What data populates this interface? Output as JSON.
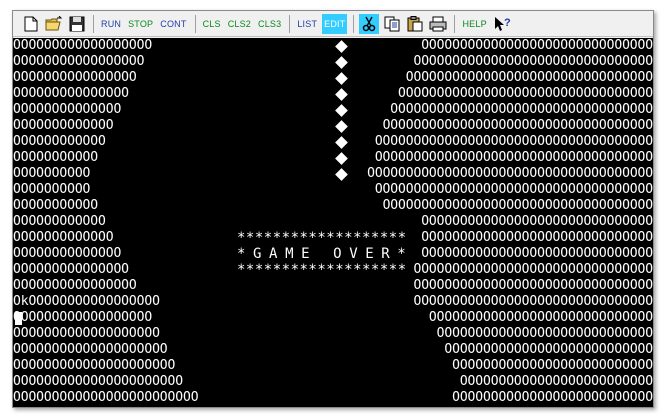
{
  "toolbar": {
    "buttons": [
      {
        "name": "new-file-button",
        "icon": "new-file-icon"
      },
      {
        "name": "open-file-button",
        "icon": "folder-open-icon"
      },
      {
        "name": "save-file-button",
        "icon": "floppy-disk-icon"
      }
    ],
    "run_label": "RUN",
    "stop_label": "STOP",
    "cont_label": "CONT",
    "cls_label": "CLS",
    "cls2_label": "CLS2",
    "cls3_label": "CLS3",
    "list_label": "LIST",
    "edit_label": "EDIT",
    "help_label": "HELP",
    "edit_icons": [
      "scissors-icon",
      "copy-icon",
      "paste-icon",
      "printer-icon"
    ],
    "whats_this_icon": "help-pointer-icon"
  },
  "screen": {
    "rows": [
      {
        "left": "OOOOOOOOOOOOOOOOOO",
        "right": "OOOOOOOOOOOOOOOOOOOOOOOOOOOOOO"
      },
      {
        "left": "OOOOOOOOOOOOOOOOO",
        "right": "OOOOOOOOOOOOOOOOOOOOOOOOOOOOOOO"
      },
      {
        "left": "OOOOOOOOOOOOOOOO",
        "right": "OOOOOOOOOOOOOOOOOOOOOOOOOOOOOOOO"
      },
      {
        "left": "OOOOOOOOOOOOOOO",
        "right": "OOOOOOOOOOOOOOOOOOOOOOOOOOOOOOOOO"
      },
      {
        "left": "OOOOOOOOOOOOOO",
        "right": "OOOOOOOOOOOOOOOOOOOOOOOOOOOOOOOOOO"
      },
      {
        "left": "OOOOOOOOOOOOO",
        "right": "OOOOOOOOOOOOOOOOOOOOOOOOOOOOOOOOOOO"
      },
      {
        "left": "OOOOOOOOOOOO",
        "right": "OOOOOOOOOOOOOOOOOOOOOOOOOOOOOOOOOOOO"
      },
      {
        "left": "OOOOOOOOOOO",
        "right": "OOOOOOOOOOOOOOOOOOOOOOOOOOOOOOOOOOOO"
      },
      {
        "left": "OOOOOOOOOO",
        "right": "OOOOOOOOOOOOOOOOOOOOOOOOOOOOOOOOOOOOO"
      },
      {
        "left": "OOOOOOOOOO",
        "right": "OOOOOOOOOOOOOOOOOOOOOOOOOOOOOOOOOOOO"
      },
      {
        "left": "OOOOOOOOOOO",
        "right": "OOOOOOOOOOOOOOOOOOOOOOOOOOOOOOOOOOO"
      },
      {
        "left": "OOOOOOOOOOOO",
        "right": "OOOOOOOOOOOOOOOOOOOOOOOOOOOOOO"
      },
      {
        "left": "OOOOOOOOOOOOO",
        "right": "OOOOOOOOOOOOOOOOOOOOOOOOOOOOOO"
      },
      {
        "left": "OOOOOOOOOOOOOO",
        "right": "OOOOOOOOOOOOOOOOOOOOOOOOOOOOOO"
      },
      {
        "left": "OOOOOOOOOOOOOOO",
        "right": "OOOOOOOOOOOOOOOOOOOOOOOOOOOOOOO"
      },
      {
        "left": "OOOOOOOOOOOOOOOO",
        "right": "OOOOOOOOOOOOOOOOOOOOOOOOOOOOOOO"
      },
      {
        "left": "OkOOOOOOOOOOOOOOOOO",
        "right": "OOOOOOOOOOOOOOOOOOOOOOOOOOOOOOO"
      },
      {
        "left": "OOOOOOOOOOOOOOOOOO",
        "right": "OOOOOOOOOOOOOOOOOOOOOOOOOOOOO"
      },
      {
        "left": "OOOOOOOOOOOOOOOOOOO",
        "right": "OOOOOOOOOOOOOOOOOOOOOOOOOOOO"
      },
      {
        "left": "OOOOOOOOOOOOOOOOOOOO",
        "right": "OOOOOOOOOOOOOOOOOOOOOOOOOOO"
      },
      {
        "left": "OOOOOOOOOOOOOOOOOOOOO",
        "right": "OOOOOOOOOOOOOOOOOOOOOOOOOO"
      },
      {
        "left": "OOOOOOOOOOOOOOOOOOOOOO",
        "right": "OOOOOOOOOOOOOOOOOOOOOOOOO"
      },
      {
        "left": "OOOOOOOOOOOOOOOOOOOOOOOO",
        "right": "OOOOOOOOOOOOOOOOOOOOOOOOOO"
      }
    ],
    "game_over_stars": "*******************",
    "game_over_text": "*GAME OVER*",
    "player_count": 9
  }
}
